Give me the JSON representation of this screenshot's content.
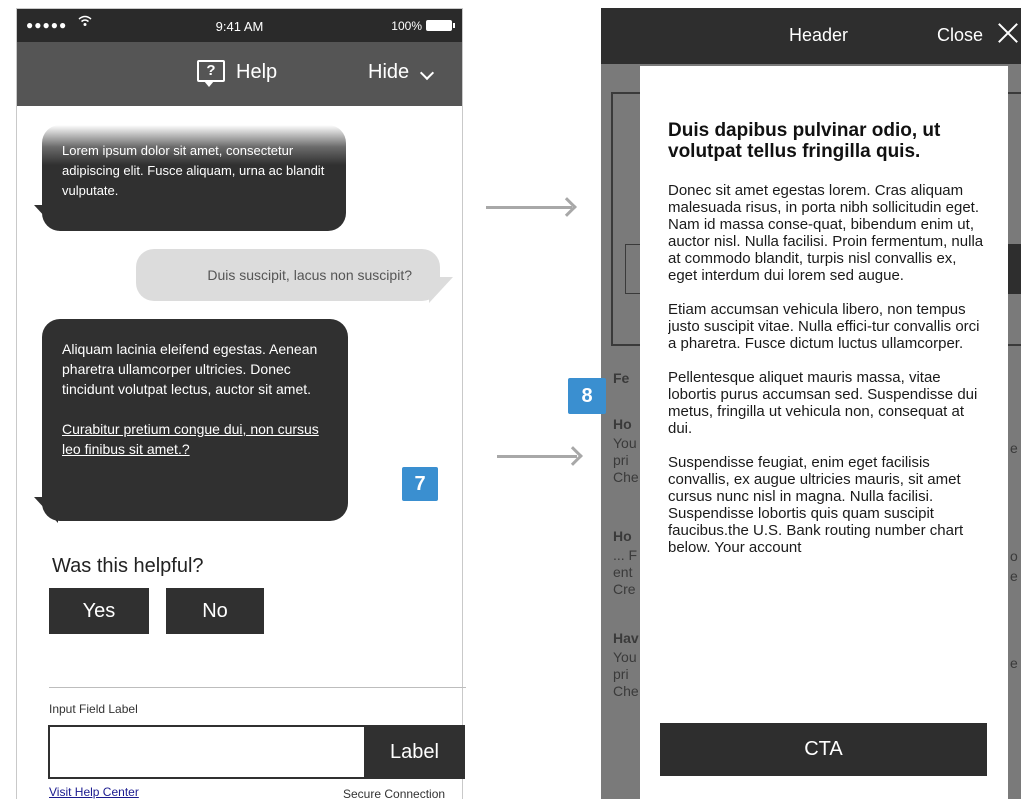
{
  "left_screen": {
    "status_bar": {
      "signal": "●●●●●",
      "time": "9:41 AM",
      "battery": "100%"
    },
    "nav": {
      "help_label": "Help",
      "help_icon_glyph": "?",
      "hide_label": "Hide"
    },
    "messages": [
      {
        "from": "agent",
        "text": "Lorem ipsum dolor sit amet, consectetur adipiscing elit. Fusce aliquam, urna ac blandit vulputate."
      },
      {
        "from": "user",
        "text": "Duis suscipit, lacus non suscipit?"
      },
      {
        "from": "agent",
        "text": "Aliquam lacinia eleifend egestas. Aenean pharetra ullamcorper ultricies. Donec tincidunt volutpat lectus, auctor sit amet.",
        "link": "Curabitur pretium congue dui, non cursus leo finibus sit amet.?"
      }
    ],
    "annotation_badge": "7",
    "feedback": {
      "question": "Was this helpful?",
      "yes": "Yes",
      "no": "No"
    },
    "input": {
      "label": "Input Field Label",
      "value": "",
      "button": "Label"
    },
    "footer": {
      "help_center_link": "Visit Help Center",
      "secure": "Secure Connection"
    }
  },
  "right_screen": {
    "header": {
      "title": "Header",
      "close_label": "Close"
    },
    "annotation_badge": "8",
    "background_fragments": [
      {
        "bold": "Fe",
        "text": ""
      },
      {
        "bold": "Ho",
        "text": "You\npri\nChe"
      },
      {
        "bold": "Ho",
        "text": "... F\nent\nCre"
      },
      {
        "bold": "Hav",
        "text": "You\npri\nChe"
      }
    ],
    "background_right_fragments": [
      "e",
      "o",
      "e",
      "e"
    ],
    "modal": {
      "title": "Duis dapibus pulvinar odio, ut volutpat tellus fringilla quis.",
      "paragraphs": [
        "Donec sit amet egestas lorem. Cras aliquam malesuada risus, in porta nibh sollicitudin eget. Nam id massa conse-quat, bibendum enim ut, auctor nisl. Nulla facilisi. Proin fermentum, nulla at commodo blandit, turpis nisl convallis ex, eget interdum dui lorem sed augue.",
        "Etiam accumsan vehicula libero, non tempus justo suscipit vitae. Nulla effici-tur convallis orci a pharetra. Fusce dictum luctus ullamcorper.",
        "Pellentesque aliquet mauris massa, vitae lobortis purus accumsan sed. Suspendisse dui metus, fringilla ut vehicula non, consequat at dui.",
        "Suspendisse feugiat, enim eget facilisis convallis, ex augue ultricies mauris, sit amet cursus nunc nisl in magna. Nulla facilisi. Suspendisse lobortis quis quam suscipit faucibus.the U.S. Bank routing number chart below. Your account"
      ],
      "cta": "CTA"
    }
  },
  "colors": {
    "dark": "#303030",
    "nav": "#555555",
    "badge": "#3a8fd0",
    "user_bubble": "#dcdcdc",
    "overlay": "#7a7a7a"
  }
}
